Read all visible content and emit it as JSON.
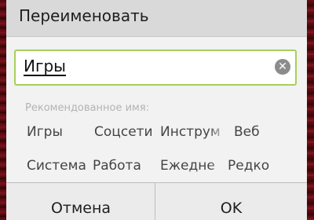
{
  "dialog": {
    "title": "Переименовать",
    "input": {
      "value": "Игры"
    },
    "suggestions_label": "Рекомендованное имя:",
    "suggestions": [
      "Игры",
      "Соцсети",
      "Инструм",
      "Веб",
      "Система",
      "Работа",
      "Ежедне",
      "Редко"
    ],
    "cancel_label": "Отмена",
    "ok_label": "OK"
  },
  "icons": {
    "clear": "clear-icon"
  },
  "colors": {
    "input_border": "#a6d05a",
    "background": "#5a0b10",
    "dialog": "#f2f2f2"
  }
}
